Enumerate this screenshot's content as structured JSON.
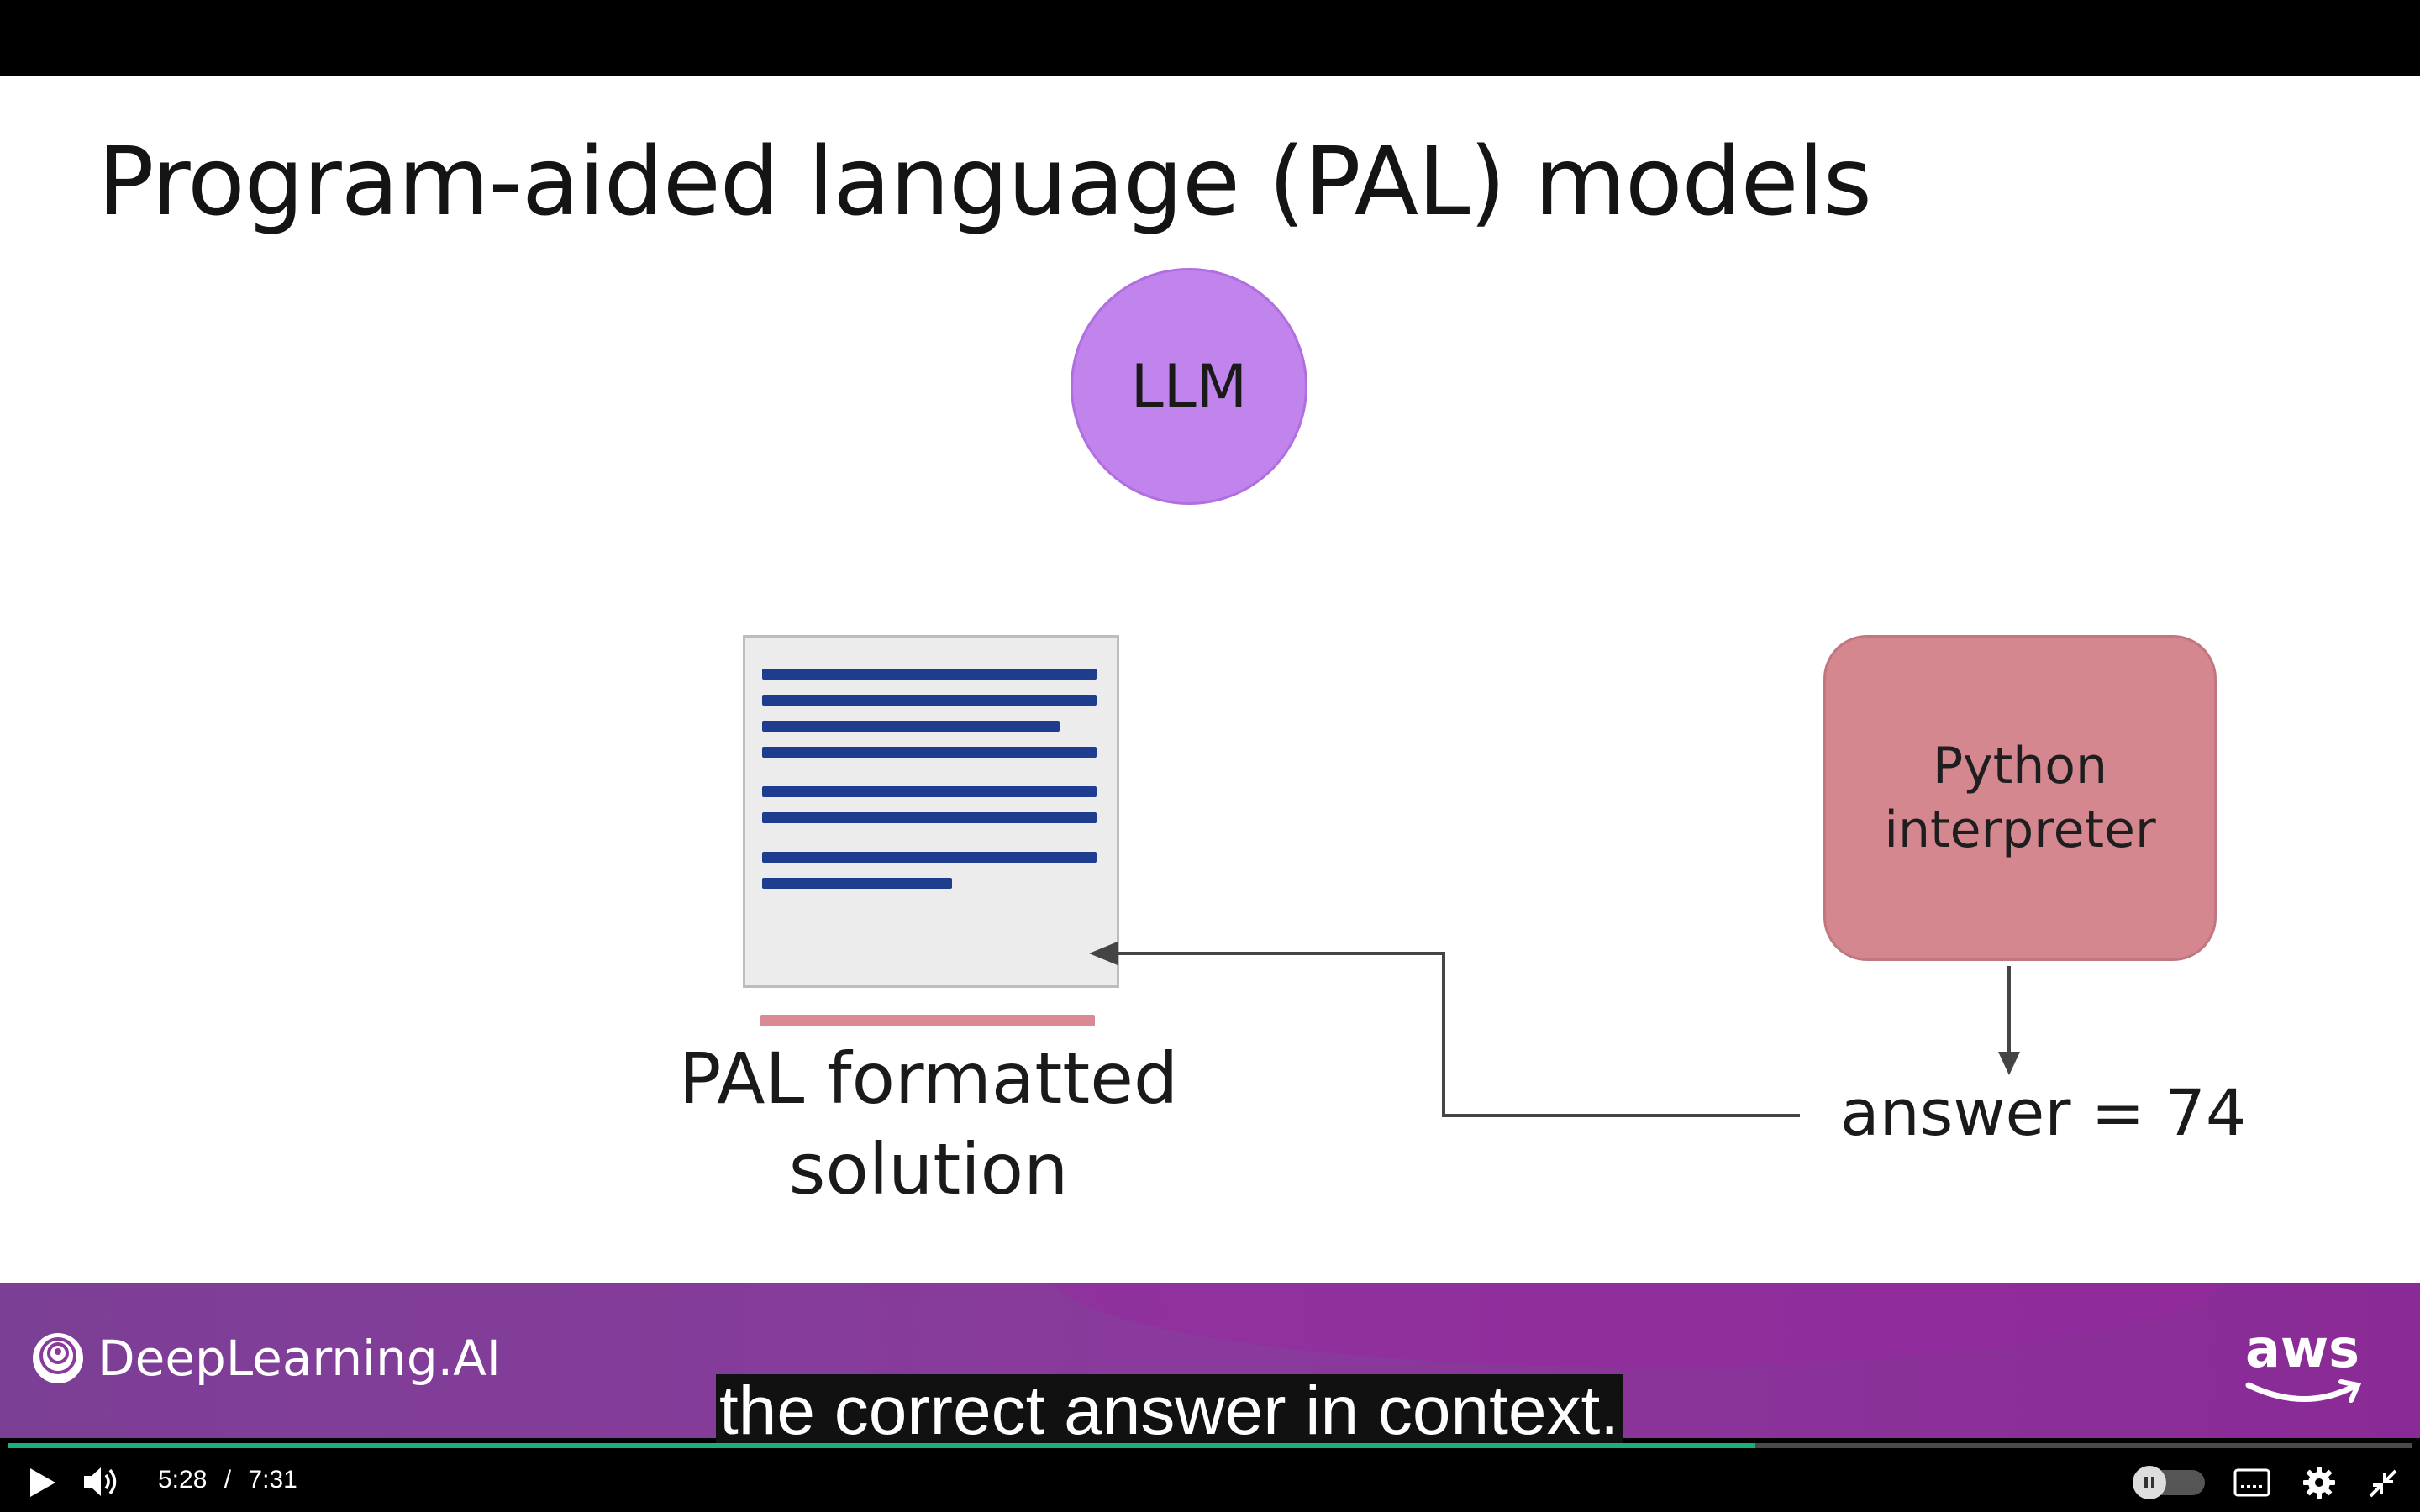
{
  "slide": {
    "title": "Program-aided language (PAL) models",
    "llm_label": "LLM",
    "doc_caption_line1": "PAL formatted",
    "doc_caption_line2": "solution",
    "interpreter_line1": "Python",
    "interpreter_line2": "interpreter",
    "answer": "answer = 74"
  },
  "footer": {
    "brand": "DeepLearning.AI",
    "partner": "aws"
  },
  "subtitle": "the correct answer in context.",
  "player": {
    "current_time": "5:28",
    "separator": "/",
    "duration": "7:31",
    "progress": 0.727,
    "icons": [
      "play-icon",
      "volume-icon",
      "pause-toggle-icon",
      "captions-icon",
      "settings-icon",
      "exit-fullscreen-icon"
    ]
  },
  "colors": {
    "llm_circle": "#c084ec",
    "interpreter_box": "#d4878f",
    "doc_lines": "#1e3d8f",
    "footer_purple": "#7c3f96",
    "progress": "#1bb07a"
  }
}
